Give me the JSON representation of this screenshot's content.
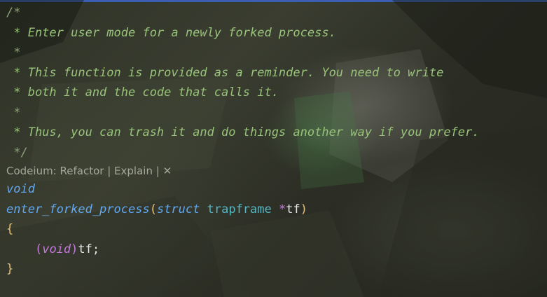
{
  "comment": {
    "open": "/*",
    "line1": " * Enter user mode for a newly forked process.",
    "line2": " *",
    "line3": " * This function is provided as a reminder. You need to write",
    "line4": " * both it and the code that calls it.",
    "line5": " *",
    "line6": " * Thus, you can trash it and do things another way if you prefer.",
    "close": " */"
  },
  "codelens": {
    "prefix": "Codeium: ",
    "refactor": "Refactor",
    "sep1": " | ",
    "explain": "Explain",
    "sep2": " | ",
    "close": "✕"
  },
  "code": {
    "return_type": "void",
    "func_name": "enter_forked_process",
    "open_paren": "(",
    "struct_kw": "struct",
    "type_name": "trapframe",
    "ptr": "*",
    "param": "tf",
    "close_paren": ")",
    "open_brace": "{",
    "indent": "    ",
    "cast_open": "(",
    "cast_type": "void",
    "cast_close": ")",
    "cast_target": "tf",
    "semicolon": ";",
    "close_brace": "}"
  },
  "colors": {
    "comment": "#98c379",
    "keyword": "#61a8f0",
    "type": "#56b6c2",
    "bracket": "#e5c07b",
    "pointer": "#c678dd",
    "identifier": "#e6e6e6",
    "codelens": "#a3a79a",
    "accent_bar": "#3a5fb0"
  }
}
